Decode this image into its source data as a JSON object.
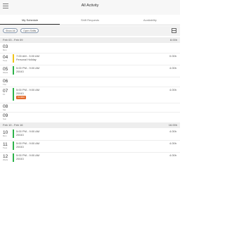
{
  "header": {
    "title": "All Activity",
    "menu_icon": "menu-icon"
  },
  "tabs": [
    {
      "label": "My Schedule",
      "active": true
    },
    {
      "label": "Shift Requests",
      "active": false
    },
    {
      "label": "Availability",
      "active": false
    }
  ],
  "filters": {
    "show_all": "Show All",
    "open_shifts": "Open Shifts",
    "calendar_icon": "calendar-icon"
  },
  "weeks": [
    {
      "range": "Feb 03 - Feb 09",
      "total": "8.00h",
      "days": [
        {
          "num": "03",
          "dow": "Mon",
          "shifts": []
        },
        {
          "num": "04",
          "dow": "Tues",
          "shifts": [
            {
              "time": "7:00 AM - 3:00 AM",
              "sub": "Personal Holiday",
              "hours": "0.00h",
              "color": "#f0c419"
            }
          ]
        },
        {
          "num": "05",
          "dow": "Weds",
          "shifts": [
            {
              "time": "5:00 PM - 9:00 AM",
              "sub": "20043",
              "hours": "4.00h",
              "color": "#2db34a"
            }
          ]
        },
        {
          "num": "06",
          "dow": "Thu",
          "shifts": []
        },
        {
          "num": "07",
          "dow": "Fri",
          "shifts": [
            {
              "time": "5:00 PM - 9:00 AM",
              "sub": "20043",
              "hours": "4.00h",
              "color": "#2db34a",
              "flag": "Conflict"
            }
          ]
        },
        {
          "num": "08",
          "dow": "Sat",
          "shifts": []
        },
        {
          "num": "09",
          "dow": "Sun",
          "shifts": []
        }
      ]
    },
    {
      "range": "Feb 10 - Feb 16",
      "total": "16.00h",
      "days": [
        {
          "num": "10",
          "dow": "Mon",
          "shifts": [
            {
              "time": "5:00 PM - 9:00 AM",
              "sub": "20043",
              "hours": "4.00h",
              "color": "#2db34a"
            }
          ]
        },
        {
          "num": "11",
          "dow": "Tues",
          "shifts": [
            {
              "time": "5:00 PM - 9:00 AM",
              "sub": "20043",
              "hours": "4.00h",
              "color": "#2db34a"
            }
          ]
        },
        {
          "num": "12",
          "dow": "Weds",
          "shifts": [
            {
              "time": "5:00 PM - 9:00 AM",
              "sub": "20043",
              "hours": "4.00h",
              "color": "#2db34a"
            }
          ]
        }
      ]
    }
  ]
}
